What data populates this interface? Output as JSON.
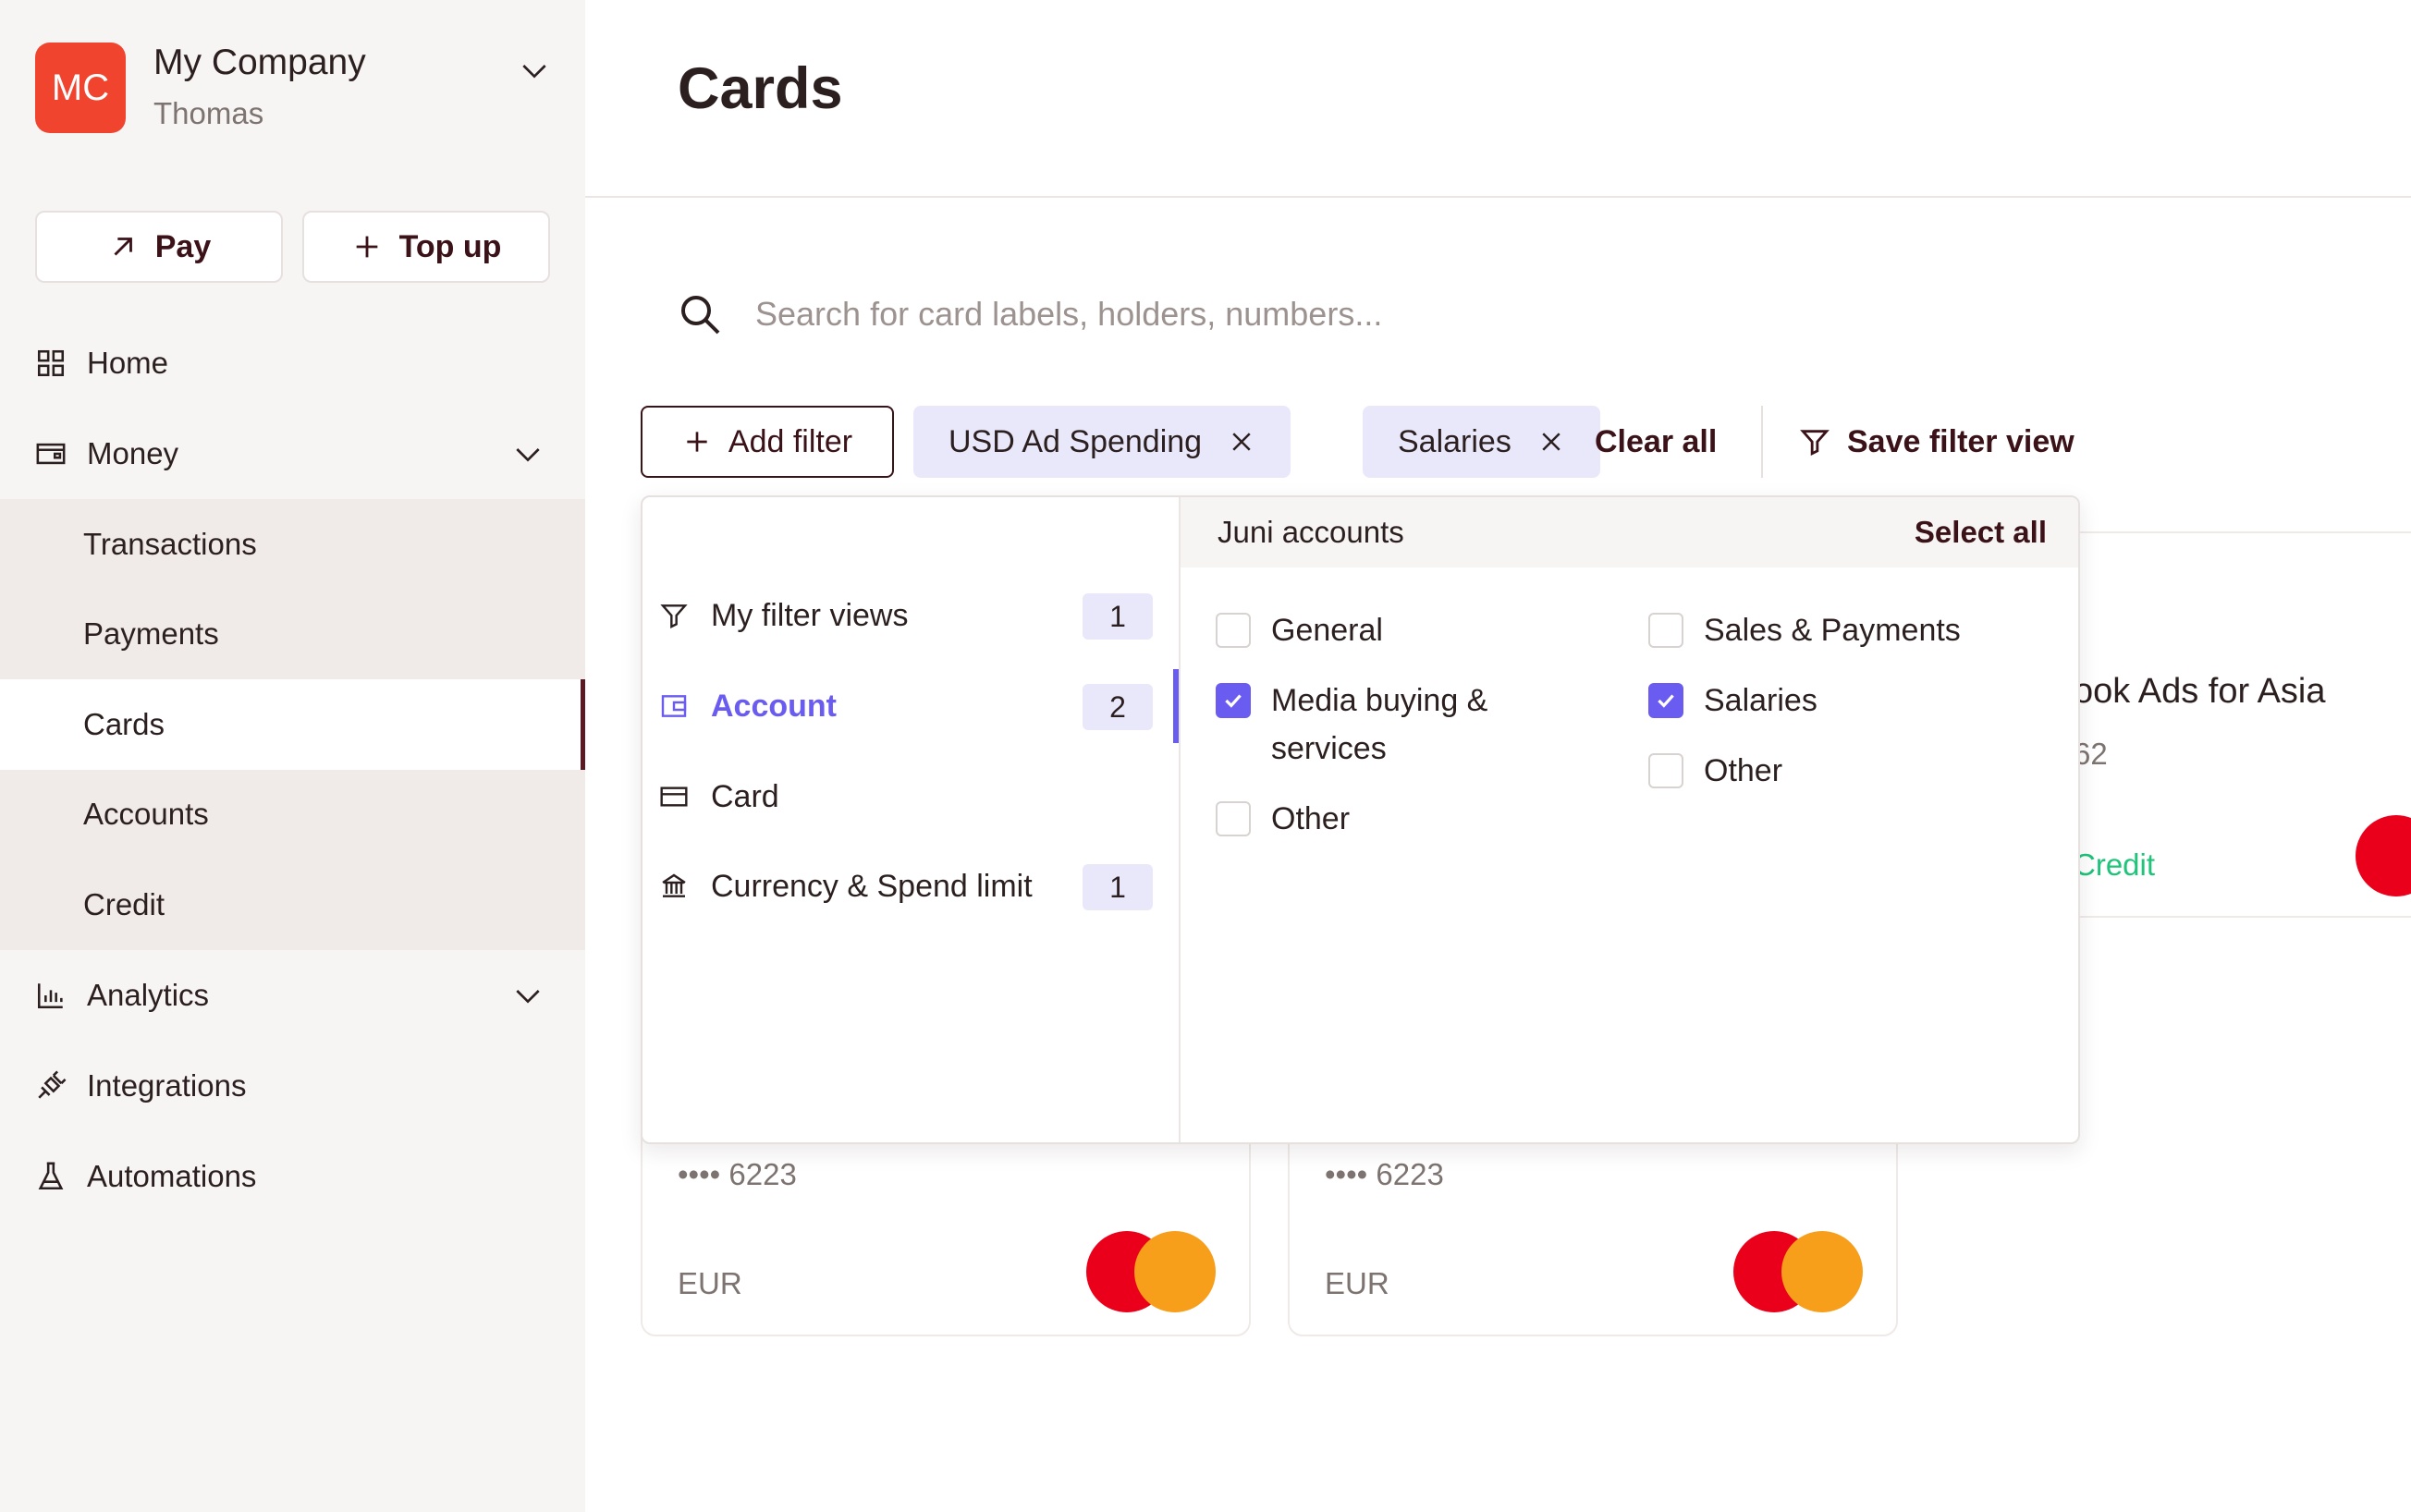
{
  "company": {
    "initials": "MC",
    "name": "My Company",
    "user": "Thomas"
  },
  "actions": {
    "pay": "Pay",
    "top_up": "Top up"
  },
  "nav": {
    "home": "Home",
    "money": "Money",
    "money_items": [
      "Transactions",
      "Payments",
      "Cards",
      "Accounts",
      "Credit"
    ],
    "analytics": "Analytics",
    "integrations": "Integrations",
    "automations": "Automations"
  },
  "page": {
    "title": "Cards"
  },
  "search": {
    "placeholder": "Search for card labels, holders, numbers..."
  },
  "filters": {
    "add_filter": "Add filter",
    "chips": [
      "USD Ad Spending",
      "Salaries"
    ],
    "clear_all": "Clear all",
    "save_view": "Save filter view"
  },
  "dropdown": {
    "categories": [
      {
        "label": "My filter views",
        "count": "1",
        "icon": "filter-icon"
      },
      {
        "label": "Account",
        "count": "2",
        "icon": "wallet-icon"
      },
      {
        "label": "Card",
        "count": "",
        "icon": "card-icon"
      },
      {
        "label": "Currency & Spend limit",
        "count": "1",
        "icon": "bank-icon"
      }
    ],
    "section_title": "Juni accounts",
    "select_all": "Select all",
    "options_left": [
      {
        "label": "General",
        "checked": false
      },
      {
        "label": "Media buying & services",
        "checked": true
      },
      {
        "label": "Other",
        "checked": false
      }
    ],
    "options_right": [
      {
        "label": "Sales & Payments",
        "checked": false
      },
      {
        "label": "Salaries",
        "checked": true
      },
      {
        "label": "Other",
        "checked": false
      }
    ]
  },
  "cards": [
    {
      "number": "•••• 6223",
      "currency": "EUR"
    },
    {
      "number": "•••• 6223",
      "currency": "EUR"
    }
  ],
  "partial_card": {
    "title": "ook Ads for Asia",
    "number": "62",
    "type": "Credit"
  },
  "colors": {
    "brand": "#f0442f",
    "accent": "#6a5cf0",
    "primary_text": "#3b1218",
    "credit": "#1fc37a"
  }
}
